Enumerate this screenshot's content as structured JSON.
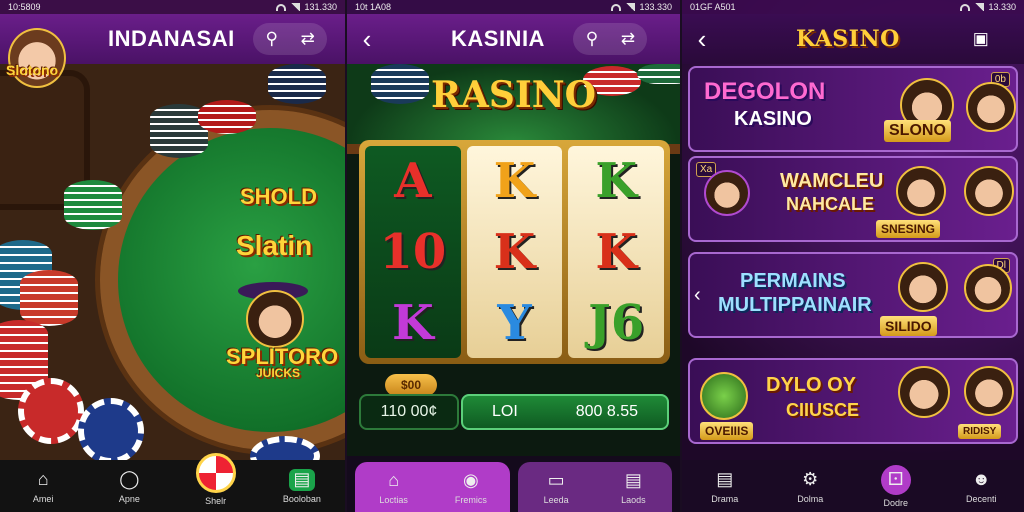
{
  "screen1": {
    "status_left": "10:5809",
    "status_right": "131.330",
    "title": "INDANASAI",
    "mascot_caption": "Slotono",
    "logo_top": "SHOLD",
    "logo_mid": "Slatin",
    "logo_bottom": "SPLITORO",
    "logo_bottom_sub": "JUICKS",
    "nav": [
      {
        "label": "Amei",
        "icon": "home-icon"
      },
      {
        "label": "Apne",
        "icon": "chip-icon"
      },
      {
        "label": "Shelr",
        "icon": "wheel-icon"
      },
      {
        "label": "Booloban",
        "icon": "shop-icon"
      }
    ]
  },
  "screen2": {
    "status_left": "10t 1A08",
    "status_right": "133.330",
    "title": "KASINIA",
    "brand": "RASINO",
    "reels": [
      [
        "A",
        "10",
        "K"
      ],
      [
        "K",
        "K",
        "Y"
      ],
      [
        "K",
        "K",
        "J6"
      ]
    ],
    "bet_chip": "$00",
    "balance": "110 00¢",
    "win_left": "LOI",
    "win_right": "800 8.55",
    "nav": [
      {
        "label": "Loctias",
        "icon": "home-icon"
      },
      {
        "label": "Fremics",
        "icon": "ball-icon"
      },
      {
        "label": "Leeda",
        "icon": "chair-icon"
      },
      {
        "label": "Laods",
        "icon": "cards-icon"
      }
    ]
  },
  "screen3": {
    "status_left": "01GF A501",
    "status_right": "13.330",
    "title": "KASINO",
    "cards": [
      {
        "headline": "DEGOLON",
        "sub": "KASINO",
        "badge": "SLONO",
        "tag": "0b"
      },
      {
        "headline": "WAMCLEU",
        "sub": "NAHCALE",
        "badge": "SNESING",
        "tag": "Xa"
      },
      {
        "headline": "PERMAINS",
        "sub": "MULTIPPAINAIR",
        "badge": "SILIDO",
        "tag": "Dl"
      },
      {
        "headline": "DYLO OY",
        "sub": "CIIUSCE",
        "badge": "OVEIIIS",
        "tag": "RIDISY"
      }
    ],
    "nav": [
      {
        "label": "Drama",
        "icon": "table-icon"
      },
      {
        "label": "Dolma",
        "icon": "gear-icon"
      },
      {
        "label": "Dodre",
        "icon": "dice-icon"
      },
      {
        "label": "Decenti",
        "icon": "avatar-icon"
      }
    ]
  },
  "colors": {
    "accent_purple": "#6a1e8a",
    "gold": "#ffd53a",
    "felt_green": "#1b8a35"
  }
}
